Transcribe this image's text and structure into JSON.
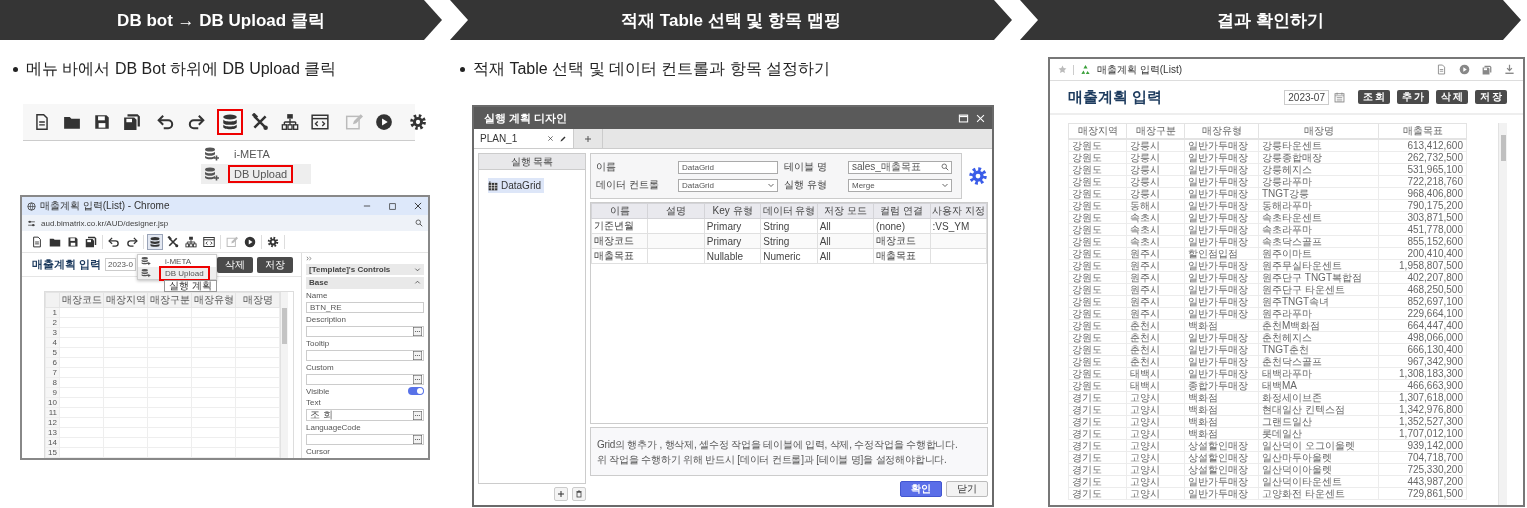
{
  "steps": [
    {
      "title": "DB bot → DB Upload 클릭"
    },
    {
      "title": "적재 Table 선택 및 항목 맵핑"
    },
    {
      "title": "결과 확인하기"
    }
  ],
  "menu_step": {
    "note": "메뉴 바에서 DB Bot 하위에 DB Upload 클릭",
    "toolbar": [
      [
        {
          "kind": "doc",
          "highlighted": false,
          "disabled": false
        },
        {
          "kind": "folder",
          "highlighted": false,
          "disabled": false
        },
        {
          "kind": "save",
          "highlighted": false,
          "disabled": false
        },
        {
          "kind": "saveall",
          "highlighted": false,
          "disabled": false
        }
      ],
      [
        {
          "kind": "undo",
          "highlighted": false,
          "disabled": false
        },
        {
          "kind": "redo",
          "highlighted": false,
          "disabled": false
        }
      ],
      [
        {
          "kind": "database",
          "highlighted": true,
          "disabled": false
        },
        {
          "kind": "tools",
          "highlighted": false,
          "disabled": false
        },
        {
          "kind": "hierarchy",
          "highlighted": false,
          "disabled": false
        },
        {
          "kind": "code",
          "highlighted": false,
          "disabled": false
        }
      ],
      [
        {
          "kind": "edit",
          "highlighted": false,
          "disabled": true
        },
        {
          "kind": "play",
          "highlighted": false,
          "disabled": false
        }
      ],
      [
        {
          "kind": "gear",
          "highlighted": false,
          "disabled": false
        }
      ]
    ],
    "menu": [
      {
        "label": "i-META",
        "selected": false
      },
      {
        "label": "DB Upload",
        "selected": true
      }
    ],
    "browser": {
      "title": "매출계획 입력(List) - Chrome",
      "url": "aud.bimatrix.co.kr/AUD/designer.jsp",
      "toolbar": [
        [
          {
            "kind": "doc",
            "selected": false,
            "disabled": false
          },
          {
            "kind": "folder",
            "selected": false,
            "disabled": false
          },
          {
            "kind": "save",
            "selected": false,
            "disabled": false
          },
          {
            "kind": "saveall",
            "selected": false,
            "disabled": false
          }
        ],
        [
          {
            "kind": "undo",
            "selected": false,
            "disabled": false
          },
          {
            "kind": "redo",
            "selected": false,
            "disabled": false
          }
        ],
        [
          {
            "kind": "database",
            "selected": true,
            "disabled": false
          },
          {
            "kind": "tools",
            "selected": false,
            "disabled": false
          },
          {
            "kind": "hierarchy",
            "selected": false,
            "disabled": false
          },
          {
            "kind": "code",
            "selected": false,
            "disabled": false
          }
        ],
        [
          {
            "kind": "edit",
            "selected": false,
            "disabled": true
          },
          {
            "kind": "play",
            "selected": false,
            "disabled": false
          }
        ],
        [
          {
            "kind": "gear",
            "selected": false,
            "disabled": false
          }
        ]
      ],
      "menu": [
        {
          "label": "i-META",
          "selected": false
        },
        {
          "label": "DB Upload",
          "selected": true
        }
      ],
      "tooltip": "실행 계획",
      "page_title": "매출계획 입력",
      "date": "2023-0",
      "buttons": [
        "삭제",
        "저장"
      ],
      "grid": {
        "columns": [
          "매장코드",
          "매장지역",
          "매장구분",
          "매장유형",
          "매장명"
        ],
        "row_numbers": [
          "1",
          "2",
          "3",
          "4",
          "5",
          "6",
          "7",
          "8",
          "9",
          "10",
          "11",
          "12",
          "13",
          "14",
          "15"
        ]
      },
      "properties": {
        "section": "[Template]'s Controls",
        "group": "Base",
        "fields": [
          {
            "label": "Name",
            "kind": "text",
            "value": "BTN_RE"
          },
          {
            "label": "Description",
            "kind": "more"
          },
          {
            "label": "Tooltip",
            "kind": "more"
          },
          {
            "label": "Custom",
            "kind": "more"
          },
          {
            "label": "Visible",
            "kind": "toggle",
            "on": true
          },
          {
            "label": "Text",
            "kind": "more",
            "value": "조 회"
          },
          {
            "label": "LanguageCode",
            "kind": "more"
          },
          {
            "label": "Cursor",
            "kind": "label"
          }
        ]
      }
    }
  },
  "mapping_step": {
    "note": "적재 Table 선택 및 데이터 컨트롤과 항목 설정하기",
    "dialog": {
      "title": "실행 계획 디자인",
      "tabs": [
        {
          "label": "PLAN_1",
          "selected": true
        }
      ],
      "list_title": "실행 목록",
      "list_items": [
        {
          "label": "DataGrid",
          "selected": true
        }
      ],
      "form": [
        {
          "label": "이름",
          "kind": "text",
          "value": "DataGrid"
        },
        {
          "label": "테이블 명",
          "kind": "search",
          "value": "sales_매출목표"
        },
        {
          "label": "데이터 컨트롤",
          "kind": "select",
          "value": "DataGrid"
        },
        {
          "label": "실행 유형",
          "kind": "select",
          "value": "Merge"
        }
      ],
      "columns": [
        "이름",
        "설명",
        "Key 유형",
        "데이터 유형",
        "저장 모드",
        "컬럼 연결",
        "사용자 지정"
      ],
      "rows": [
        [
          "기준년월",
          null,
          "Primary",
          "String",
          "All",
          "(none)",
          ":VS_YM"
        ],
        [
          "매장코드",
          null,
          "Primary",
          "String",
          "All",
          "매장코드",
          null
        ],
        [
          "매출목표",
          null,
          "Nullable",
          "Numeric",
          "All",
          "매출목표",
          null
        ]
      ],
      "help": [
        "Grid의 행추가 , 행삭제, 셀수정 작업을 테이블에 입력, 삭제, 수정작업을 수행합니다.",
        "위 작업을 수행하기 위해 반드시 [데이터 컨트롤]과 [테이블 명]을 설정해야합니다."
      ],
      "buttons": [
        {
          "label": "확인",
          "kind": "primary"
        },
        {
          "label": "닫기",
          "kind": "secondary"
        }
      ]
    }
  },
  "result_step": {
    "window_title": "매출계획 입력(List)",
    "page_title": "매출계획 입력",
    "date": "2023-07",
    "buttons": [
      "조 회",
      "추 가",
      "삭 제",
      "저 장"
    ],
    "columns": [
      "매장지역",
      "매장구분",
      "매장유형",
      "매장명",
      "매출목표"
    ],
    "rows": [
      [
        "강원도",
        "강릉시",
        "일반가두매장",
        "강릉타운센트",
        "613,412,600"
      ],
      [
        "강원도",
        "강릉시",
        "일반가두매장",
        "강릉종합매장",
        "262,732,500"
      ],
      [
        "강원도",
        "강릉시",
        "일반가두매장",
        "강릉헤지스",
        "531,965,100"
      ],
      [
        "강원도",
        "강릉시",
        "일반가두매장",
        "강릉라푸마",
        "722,218,760"
      ],
      [
        "강원도",
        "강릉시",
        "일반가두매장",
        "TNGT강릉",
        "968,406,800"
      ],
      [
        "강원도",
        "동해시",
        "일반가두매장",
        "동해라푸마",
        "790,175,200"
      ],
      [
        "강원도",
        "속초시",
        "일반가두매장",
        "속초타운센트",
        "303,871,500"
      ],
      [
        "강원도",
        "속초시",
        "일반가두매장",
        "속초라푸마",
        "451,778,000"
      ],
      [
        "강원도",
        "속초시",
        "일반가두매장",
        "속초닥스골프",
        "855,152,600"
      ],
      [
        "강원도",
        "원주시",
        "할인점입점",
        "원주이마트",
        "200,410,400"
      ],
      [
        "강원도",
        "원주시",
        "일반가두매장",
        "원주무실타운센트",
        "1,958,807,500"
      ],
      [
        "강원도",
        "원주시",
        "일반가두매장",
        "원주단구 TNGT복합점",
        "402,207,800"
      ],
      [
        "강원도",
        "원주시",
        "일반가두매장",
        "원주단구 타운센트",
        "468,250,500"
      ],
      [
        "강원도",
        "원주시",
        "일반가두매장",
        "원주TNGT속녀",
        "852,697,100"
      ],
      [
        "강원도",
        "원주시",
        "일반가두매장",
        "원주라푸마",
        "229,664,100"
      ],
      [
        "강원도",
        "춘천시",
        "백화점",
        "춘천M백화점",
        "664,447,400"
      ],
      [
        "강원도",
        "춘천시",
        "일반가두매장",
        "춘천헤지스",
        "498,066,000"
      ],
      [
        "강원도",
        "춘천시",
        "일반가두매장",
        "TNGT춘천",
        "666,130,400"
      ],
      [
        "강원도",
        "춘천시",
        "일반가두매장",
        "춘천닥스골프",
        "967,342,900"
      ],
      [
        "강원도",
        "태백시",
        "일반가두매장",
        "태백라푸마",
        "1,308,183,300"
      ],
      [
        "강원도",
        "태백시",
        "종합가두매장",
        "태백MA",
        "466,663,900"
      ],
      [
        "경기도",
        "고양시",
        "백화점",
        "화정세이브존",
        "1,307,618,000"
      ],
      [
        "경기도",
        "고양시",
        "백화점",
        "현대일산 킨텍스점",
        "1,342,976,800"
      ],
      [
        "경기도",
        "고양시",
        "백화점",
        "그랜드일산",
        "1,352,527,300"
      ],
      [
        "경기도",
        "고양시",
        "백화점",
        "롯데일산",
        "1,707,012,100"
      ],
      [
        "경기도",
        "고양시",
        "상설할인매장",
        "일산덕이 오그이울렛",
        "939,142,000"
      ],
      [
        "경기도",
        "고양시",
        "상설할인매장",
        "일산마두아울렛",
        "704,718,700"
      ],
      [
        "경기도",
        "고양시",
        "상설할인매장",
        "일산덕이아울렛",
        "725,330,200"
      ],
      [
        "경기도",
        "고양시",
        "일반가두매장",
        "일산덕이타운센트",
        "443,987,200"
      ],
      [
        "경기도",
        "고양시",
        "일반가두매장",
        "고양화전 타운센트",
        "729,861,500"
      ]
    ]
  }
}
